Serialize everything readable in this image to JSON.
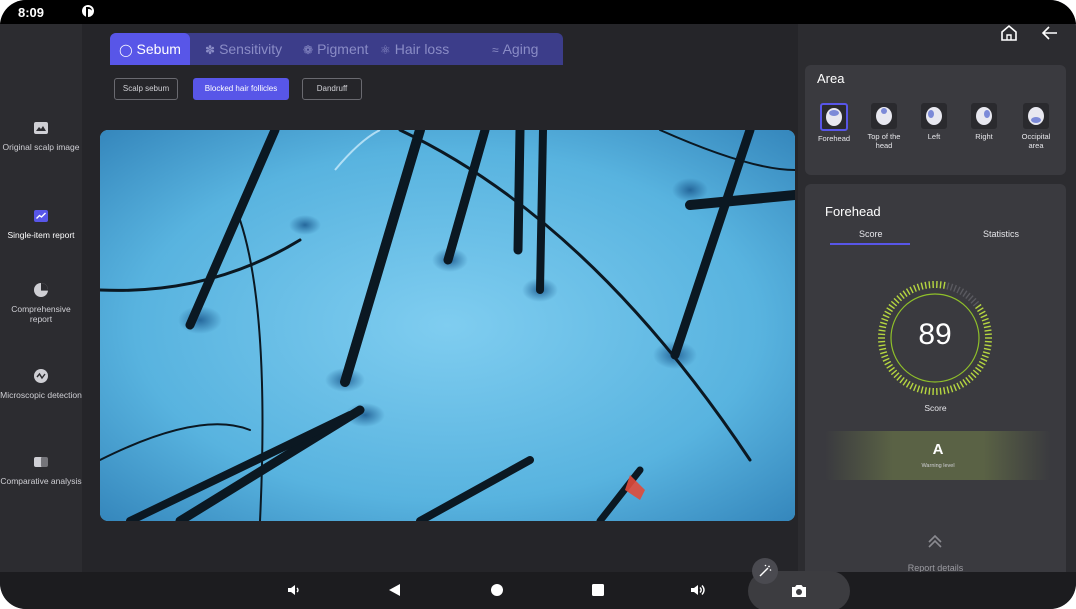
{
  "status_bar": {
    "time": "8:09"
  },
  "sidebar": {
    "items": [
      {
        "label": "Original scalp image",
        "icon": "image-icon",
        "active": false
      },
      {
        "label": "Single-item report",
        "icon": "chart-line-icon",
        "active": true
      },
      {
        "label": "Comprehensive report",
        "icon": "pie-chart-icon",
        "active": false
      },
      {
        "label": "Microscopic detection",
        "icon": "microscope-icon",
        "active": false
      },
      {
        "label": "Comparative analysis",
        "icon": "compare-icon",
        "active": false
      }
    ]
  },
  "tabs": [
    {
      "label": "Sebum",
      "active": true
    },
    {
      "label": "Sensitivity",
      "active": false
    },
    {
      "label": "Pigment",
      "active": false
    },
    {
      "label": "Hair loss",
      "active": false
    },
    {
      "label": "Aging",
      "active": false
    }
  ],
  "chips": [
    {
      "label": "Scalp sebum",
      "active": false
    },
    {
      "label": "Blocked hair follicles",
      "active": true
    },
    {
      "label": "Dandruff",
      "active": false
    }
  ],
  "area": {
    "title": "Area",
    "items": [
      {
        "label": "Forehead",
        "active": true
      },
      {
        "label": "Top of the head",
        "active": false
      },
      {
        "label": "Left",
        "active": false
      },
      {
        "label": "Right",
        "active": false
      },
      {
        "label": "Occipital area",
        "active": false
      }
    ]
  },
  "report": {
    "region": "Forehead",
    "subtabs": [
      "Score",
      "Statistics"
    ],
    "active_subtab": "Score",
    "score": "89",
    "score_label": "Score",
    "grade": "A",
    "grade_label": "Warning level",
    "details_label": "Report details"
  },
  "colors": {
    "accent": "#5856e8",
    "panel": "#3a3a3f",
    "gauge": "#b6d640"
  }
}
